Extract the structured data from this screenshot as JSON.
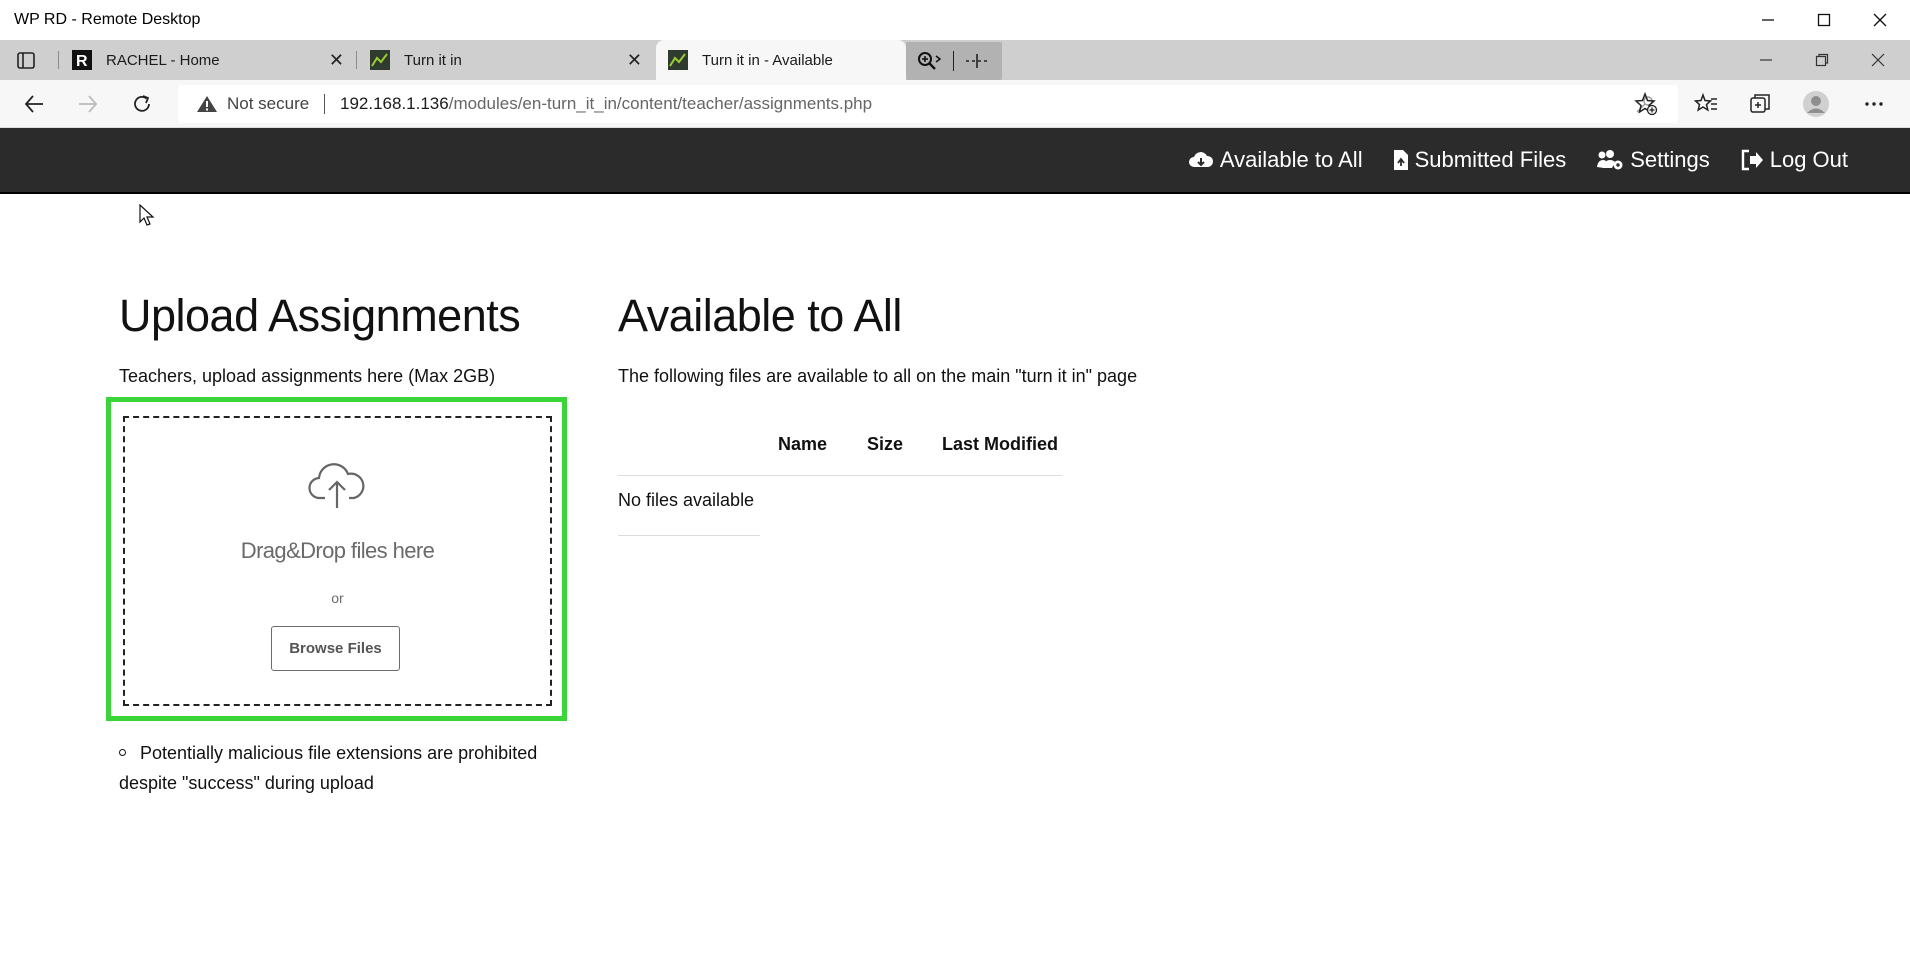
{
  "window": {
    "title": "WP RD - Remote Desktop",
    "controls": [
      "minimize-icon",
      "maximize-icon",
      "close-icon"
    ]
  },
  "browser": {
    "tabs": [
      {
        "title": "RACHEL - Home",
        "favicon": "rachel-logo-icon",
        "active": false
      },
      {
        "title": "Turn it in",
        "favicon": "turn-it-in-favicon",
        "active": false
      },
      {
        "title": "Turn it in - Available",
        "favicon": "turn-it-in-favicon",
        "active": true
      }
    ],
    "security_label": "Not secure",
    "url_host": "192.168.1.136",
    "url_path": "/modules/en-turn_it_in/content/teacher/assignments.php"
  },
  "site": {
    "nav": [
      {
        "label": "Available to All",
        "icon": "cloud-download-icon"
      },
      {
        "label": "Submitted Files",
        "icon": "file-upload-icon"
      },
      {
        "label": "Settings",
        "icon": "users-cog-icon"
      },
      {
        "label": "Log Out",
        "icon": "sign-out-icon"
      }
    ]
  },
  "upload": {
    "heading": "Upload Assignments",
    "lead": "Teachers, upload assignments here (Max 2GB)",
    "dropzone_title": "Drag&Drop files here",
    "dropzone_or": "or",
    "browse_label": "Browse Files",
    "highlight_color": "#3bd43b",
    "note": "Potentially malicious file extensions are prohibited despite \"success\" during upload"
  },
  "available": {
    "heading": "Available to All",
    "lead": "The following files are available to all on the main \"turn it in\" page",
    "columns": [
      "Name",
      "Size",
      "Last Modified"
    ],
    "empty_message": "No files available"
  }
}
